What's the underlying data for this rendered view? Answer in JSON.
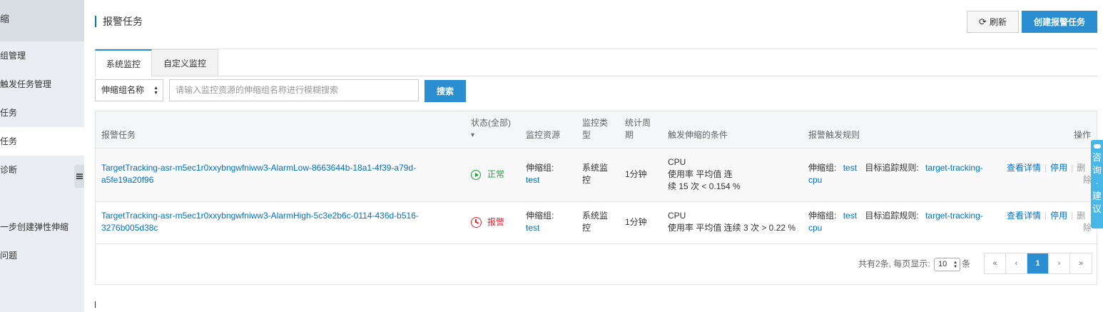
{
  "sidebar": {
    "header": "缩",
    "items": [
      {
        "label": "组管理"
      },
      {
        "label": "触发任务管理"
      },
      {
        "label": "任务"
      },
      {
        "label": "任务"
      },
      {
        "label": "诊断"
      },
      {
        "label": ""
      },
      {
        "label": "一步创建弹性伸缩"
      },
      {
        "label": "问题"
      }
    ]
  },
  "header": {
    "title": "报警任务",
    "refresh_label": "刷新",
    "create_label": "创建报警任务"
  },
  "tabs": [
    {
      "label": "系统监控"
    },
    {
      "label": "自定义监控"
    }
  ],
  "search": {
    "select_value": "伸缩组名称",
    "placeholder": "请输入监控资源的伸缩组名称进行模糊搜索",
    "button_label": "搜索"
  },
  "table": {
    "headers": {
      "task": "报警任务",
      "status_line1": "状态(全部)",
      "status_line2": "▾",
      "resource": "监控资源",
      "type_line1": "监控类",
      "type_line2": "型",
      "period_line1": "统计周",
      "period_line2": "期",
      "condition": "触发伸缩的条件",
      "rule": "报警触发规则",
      "ops": "操作"
    },
    "rows": [
      {
        "task_line1": "TargetTracking-asr-m5ec1r0xxybngwfniww3-AlarmLow-8663644b-18a1-4f39-a79d-",
        "task_line2": "a5fe19a20f96",
        "status": "正常",
        "resource_label": "伸缩组:",
        "resource_value": "test",
        "type_line1": "系统监",
        "type_line2": "控",
        "period": "1分钟",
        "cond_line1": "CPU",
        "cond_line2": "使用率 平均值 连",
        "cond_line3": "续 15 次 < 0.154 %",
        "rule_group_label": "伸缩组:",
        "rule_group_value": "test",
        "rule_target_label": "目标追踪规则:",
        "rule_target_line1": "target-tracking-",
        "rule_target_line2": "cpu",
        "op_detail": "查看详情",
        "op_disable": "停用",
        "op_delete_line1": "删",
        "op_delete_line2": "除"
      },
      {
        "task_line1": "TargetTracking-asr-m5ec1r0xxybngwfniww3-AlarmHigh-5c3e2b6c-0114-436d-b516-",
        "task_line2": "3276b005d38c",
        "status": "报警",
        "resource_label": "伸缩组:",
        "resource_value": "test",
        "type_line1": "系统监",
        "type_line2": "控",
        "period": "1分钟",
        "cond_line1": "CPU",
        "cond_line2": "使用率 平均值 连续 3 次 > 0.22 %",
        "cond_line3": "",
        "rule_group_label": "伸缩组:",
        "rule_group_value": "test",
        "rule_target_label": "目标追踪规则:",
        "rule_target_line1": "target-tracking-",
        "rule_target_line2": "cpu",
        "op_detail": "查看详情",
        "op_disable": "停用",
        "op_delete_line1": "删",
        "op_delete_line2": "除"
      }
    ]
  },
  "pagination": {
    "summary_prefix": "共有2条, 每页显示:",
    "page_size": "10",
    "summary_suffix": "条",
    "first": "«",
    "prev": "‹",
    "current": "1",
    "next": "›",
    "last": "»"
  },
  "feedback": {
    "chars": [
      "咨",
      "询",
      "·",
      "建",
      "议"
    ]
  },
  "colors": {
    "primary": "#2b8ed0",
    "link": "#0070cc",
    "ok": "#1e9e3e",
    "alarm": "#e0272f",
    "feedback": "#49b6e8"
  },
  "icons": {
    "refresh": "refresh-icon",
    "status_ok": "play-circle-icon",
    "status_alarm": "alarm-clock-icon",
    "collapse": "menu-collapse-icon"
  }
}
